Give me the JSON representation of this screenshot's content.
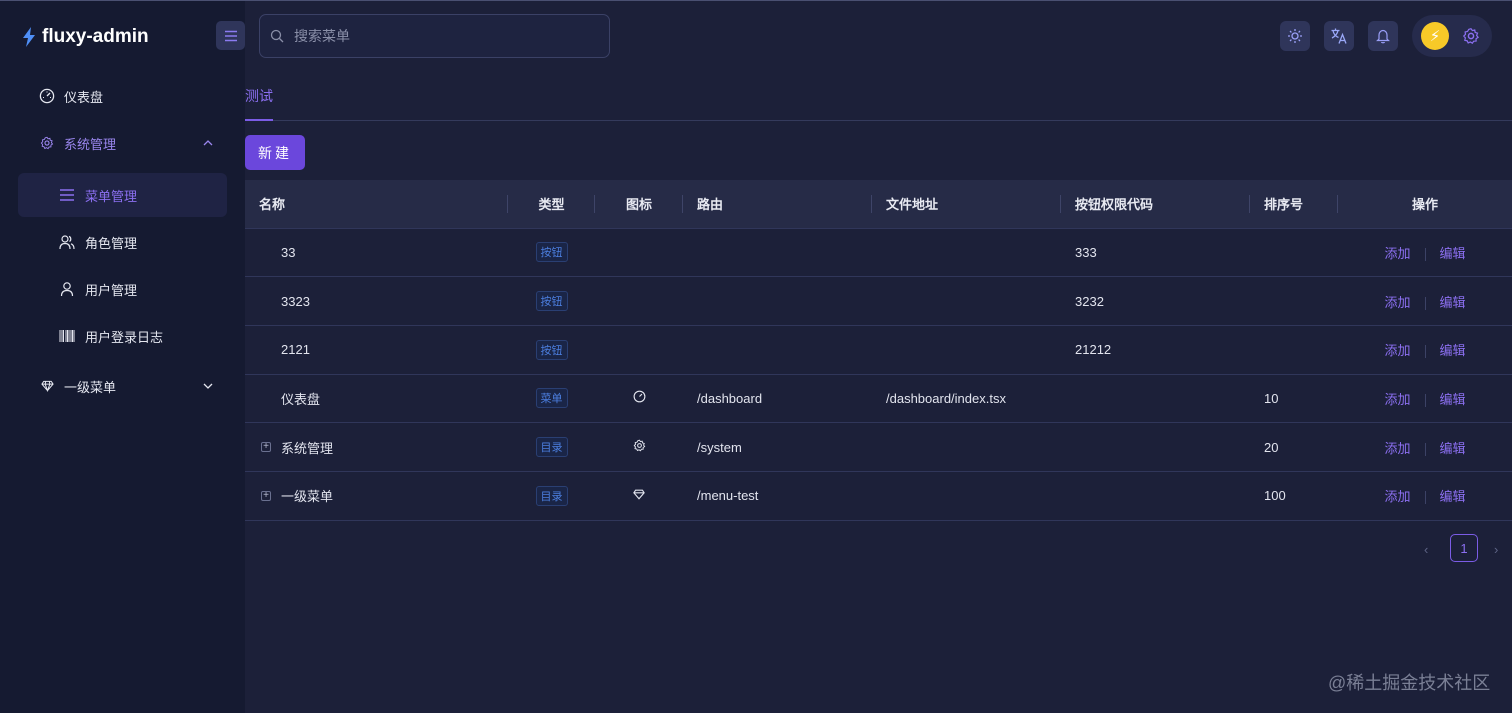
{
  "app": {
    "title": "fluxy-admin"
  },
  "sidebar": {
    "items": [
      {
        "label": "仪表盘",
        "icon": "dashboard-icon"
      },
      {
        "label": "系统管理",
        "icon": "gear-icon",
        "expanded": true
      },
      {
        "label": "菜单管理",
        "icon": "menu-icon",
        "active": true
      },
      {
        "label": "角色管理",
        "icon": "users-icon"
      },
      {
        "label": "用户管理",
        "icon": "user-icon"
      },
      {
        "label": "用户登录日志",
        "icon": "barcode-icon"
      },
      {
        "label": "一级菜单",
        "icon": "diamond-icon",
        "expanded": false
      }
    ]
  },
  "header": {
    "search_placeholder": "搜索菜单",
    "avatar_glyph": "⚡"
  },
  "tabs": [
    {
      "label": "测试",
      "active": true
    }
  ],
  "toolbar": {
    "new_label": "新建"
  },
  "table": {
    "columns": [
      "名称",
      "类型",
      "图标",
      "路由",
      "文件地址",
      "按钮权限代码",
      "排序号",
      "操作"
    ],
    "rows": [
      {
        "name": "33",
        "type": "按钮",
        "icon": "",
        "route": "",
        "file": "",
        "code": "333",
        "order": "",
        "expandable": false
      },
      {
        "name": "3323",
        "type": "按钮",
        "icon": "",
        "route": "",
        "file": "",
        "code": "3232",
        "order": "",
        "expandable": false
      },
      {
        "name": "2121",
        "type": "按钮",
        "icon": "",
        "route": "",
        "file": "",
        "code": "21212",
        "order": "",
        "expandable": false
      },
      {
        "name": "仪表盘",
        "type": "菜单",
        "icon": "dashboard-icon",
        "route": "/dashboard",
        "file": "/dashboard/index.tsx",
        "code": "",
        "order": "10",
        "expandable": false
      },
      {
        "name": "系统管理",
        "type": "目录",
        "icon": "gear-icon",
        "route": "/system",
        "file": "",
        "code": "",
        "order": "20",
        "expandable": true
      },
      {
        "name": "一级菜单",
        "type": "目录",
        "icon": "diamond-icon",
        "route": "/menu-test",
        "file": "",
        "code": "",
        "order": "100",
        "expandable": true
      }
    ],
    "actions": {
      "add": "添加",
      "edit": "编辑"
    }
  },
  "pagination": {
    "current": "1",
    "prev": "‹",
    "next": "›"
  },
  "watermark": "@稀土掘金技术社区",
  "colors": {
    "accent": "#7b5ce6",
    "sidebar_bg": "#151a31",
    "content_bg": "#1c2039",
    "badge_blue": "#4c7fe0"
  }
}
